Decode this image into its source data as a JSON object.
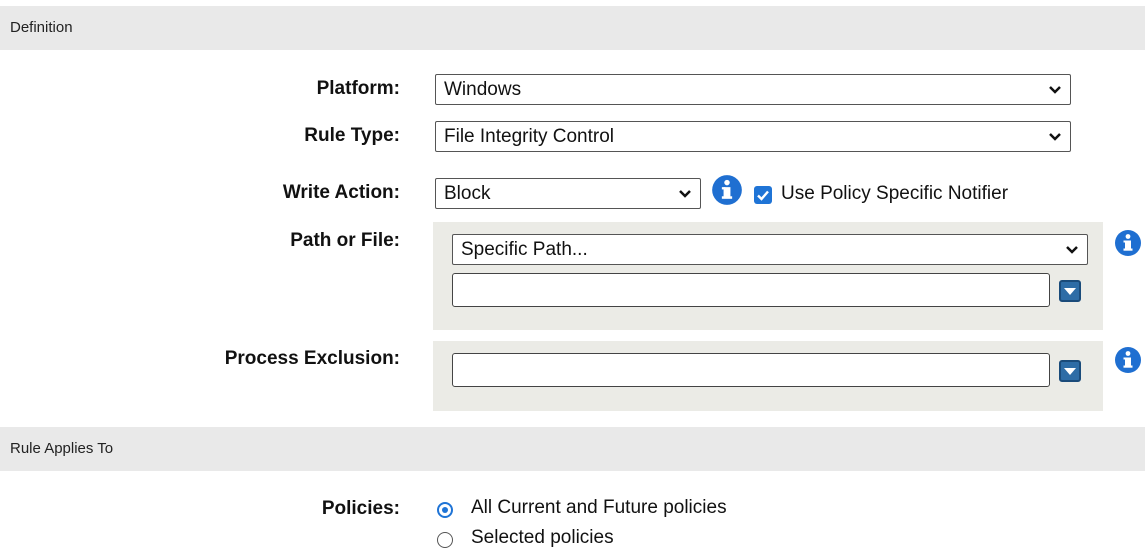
{
  "definition_header": "Definition",
  "platform": {
    "label": "Platform:",
    "value": "Windows"
  },
  "rule_type": {
    "label": "Rule Type:",
    "value": "File Integrity Control"
  },
  "write_action": {
    "label": "Write Action:",
    "value": "Block",
    "notifier_checked": true,
    "notifier_label": "Use Policy Specific Notifier"
  },
  "path_or_file": {
    "label": "Path or File:",
    "value": "Specific Path...",
    "path_value": ""
  },
  "process_exclusion": {
    "label": "Process Exclusion:",
    "value": ""
  },
  "applies_header": "Rule Applies To",
  "policies": {
    "label": "Policies:",
    "options": [
      "All Current and Future policies",
      "Selected policies"
    ],
    "selected": 0
  },
  "colors": {
    "accent": "#1f74d6",
    "info_icon": "#1f6fd1",
    "panel": "#ebebe6",
    "header": "#e9e9e9"
  },
  "icons": {
    "info": "info-icon",
    "dropdown": "dropdown-arrow-icon",
    "chevron": "chevron-down-icon"
  }
}
